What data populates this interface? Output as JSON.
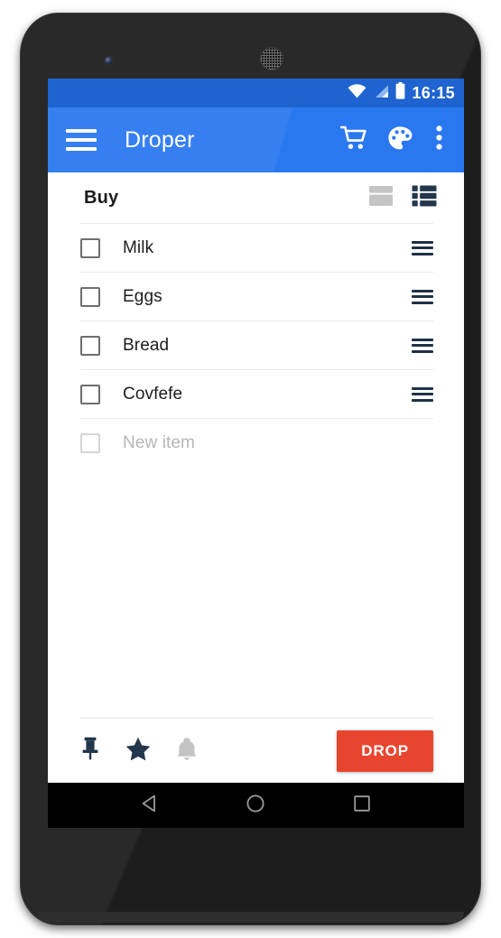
{
  "device": {
    "camera_icon": "front-camera",
    "speaker_icon": "earpiece-speaker"
  },
  "status_bar": {
    "wifi_icon": "wifi-icon",
    "signal_icon": "cellular-signal-icon",
    "battery_icon": "battery-full-icon",
    "time": "16:15",
    "background_color": "#1e63d0"
  },
  "app_bar": {
    "menu_icon": "hamburger-menu-icon",
    "title": "Droper",
    "background_color": "#2a78f0",
    "actions": [
      {
        "name": "cart-button",
        "icon": "shopping-cart-icon",
        "label": "Cart"
      },
      {
        "name": "theme-button",
        "icon": "palette-icon",
        "label": "Theme"
      },
      {
        "name": "overflow-button",
        "icon": "overflow-menu-icon",
        "label": "More options"
      }
    ]
  },
  "list_header": {
    "title": "Buy",
    "view_toggles": [
      {
        "name": "view-toggle-card",
        "icon": "card-view-icon",
        "label": "Card view",
        "active": false,
        "color": "#c4c4c4"
      },
      {
        "name": "view-toggle-list",
        "icon": "list-view-icon",
        "label": "List view",
        "active": true,
        "color": "#22364c"
      }
    ]
  },
  "items": [
    {
      "label": "Milk",
      "checked": false,
      "placeholder": false,
      "drag_handle_icon": "drag-handle-icon"
    },
    {
      "label": "Eggs",
      "checked": false,
      "placeholder": false,
      "drag_handle_icon": "drag-handle-icon"
    },
    {
      "label": "Bread",
      "checked": false,
      "placeholder": false,
      "drag_handle_icon": "drag-handle-icon"
    },
    {
      "label": "Covfefe",
      "checked": false,
      "placeholder": false,
      "drag_handle_icon": "drag-handle-icon"
    }
  ],
  "new_item": {
    "placeholder": "New item",
    "checked": false
  },
  "bottom_toolbar": {
    "icons": [
      {
        "name": "pin-button",
        "icon": "pushpin-icon",
        "label": "Pin",
        "active": true,
        "color": "#22364c"
      },
      {
        "name": "star-button",
        "icon": "star-icon",
        "label": "Favorite",
        "active": true,
        "color": "#22364c"
      },
      {
        "name": "alarm-button",
        "icon": "bell-icon",
        "label": "Reminder",
        "active": false,
        "color": "#c4c4c4"
      }
    ],
    "drop_button": {
      "label": "DROP",
      "color": "#e8452f",
      "text_color": "#ffffff"
    }
  },
  "nav_bar": {
    "buttons": [
      {
        "name": "nav-back-button",
        "icon": "back-triangle-icon",
        "label": "Back"
      },
      {
        "name": "nav-home-button",
        "icon": "home-circle-icon",
        "label": "Home"
      },
      {
        "name": "nav-recents-button",
        "icon": "recents-square-icon",
        "label": "Recents"
      }
    ],
    "background_color": "#000000"
  }
}
